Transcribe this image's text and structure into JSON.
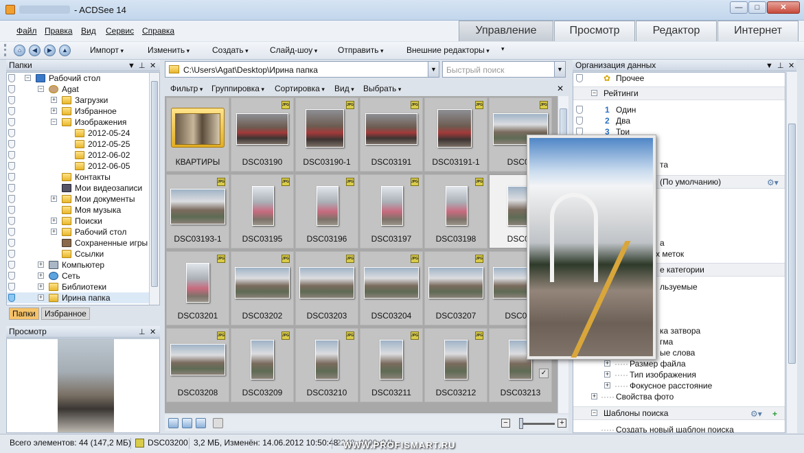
{
  "window": {
    "title": "- ACDSee 14",
    "min": "—",
    "max": "□",
    "close": "✕"
  },
  "menu": [
    "Файл",
    "Правка",
    "Вид",
    "Сервис",
    "Справка"
  ],
  "mode_tabs": [
    "Управление",
    "Просмотр",
    "Редактор",
    "Интернет"
  ],
  "toolbar": [
    "Импорт",
    "Изменить",
    "Создать",
    "Слайд-шоу",
    "Отправить",
    "Внешние редакторы"
  ],
  "folders_panel": {
    "title": "Папки",
    "items": [
      "Рабочий стол",
      "Agat",
      "Загрузки",
      "Избранное",
      "Изображения",
      "2012-05-24",
      "2012-05-25",
      "2012-06-02",
      "2012-06-05",
      "Контакты",
      "Мои видеозаписи",
      "Мои документы",
      "Моя музыка",
      "Поиски",
      "Рабочий стол",
      "Сохраненные игры",
      "Ссылки",
      "Компьютер",
      "Сеть",
      "Библиотеки",
      "Ирина папка"
    ],
    "tabs": [
      "Папки",
      "Избранное"
    ]
  },
  "preview_panel": {
    "title": "Просмотр"
  },
  "path": "C:\\Users\\Agat\\Desktop\\Ирина папка",
  "search_placeholder": "Быстрый поиск",
  "filter_bar": [
    "Фильтр",
    "Группировка",
    "Сортировка",
    "Вид",
    "Выбрать"
  ],
  "thumbnails": [
    "КВАРТИРЫ",
    "DSC03190",
    "DSC03190-1",
    "DSC03191",
    "DSC03191-1",
    "DSC03",
    "DSC03193-1",
    "DSC03195",
    "DSC03196",
    "DSC03197",
    "DSC03198",
    "DSC03",
    "DSC03201",
    "DSC03202",
    "DSC03203",
    "DSC03204",
    "DSC03207",
    "DSC032",
    "DSC03208",
    "DSC03209",
    "DSC03210",
    "DSC03211",
    "DSC03212",
    "DSC03213"
  ],
  "jpg_badge": "JPG",
  "org_panel": {
    "title": "Организация данных",
    "rows": [
      "Прочее",
      "Рейтинги",
      "Один",
      "Два",
      "Три",
      "та",
      "(По умолчанию)",
      "а",
      "х меток",
      "е категории",
      "льзуемые",
      "ка затвора",
      "гма",
      "ые слова",
      "Размер файла",
      "Тип изображения",
      "Фокусное расстояние",
      "Свойства фото",
      "Шаблоны поиска",
      "Создать новый шаблон поиска"
    ]
  },
  "status": {
    "total": "Всего элементов: 44  (147,2 МБ)",
    "file": "DSC03200",
    "info": "3,2 МБ, Изменён: 14.06.2012 10:50:48",
    "dims": "2248x4000x24b"
  },
  "watermark": "WWW.PROFISMART.RU"
}
